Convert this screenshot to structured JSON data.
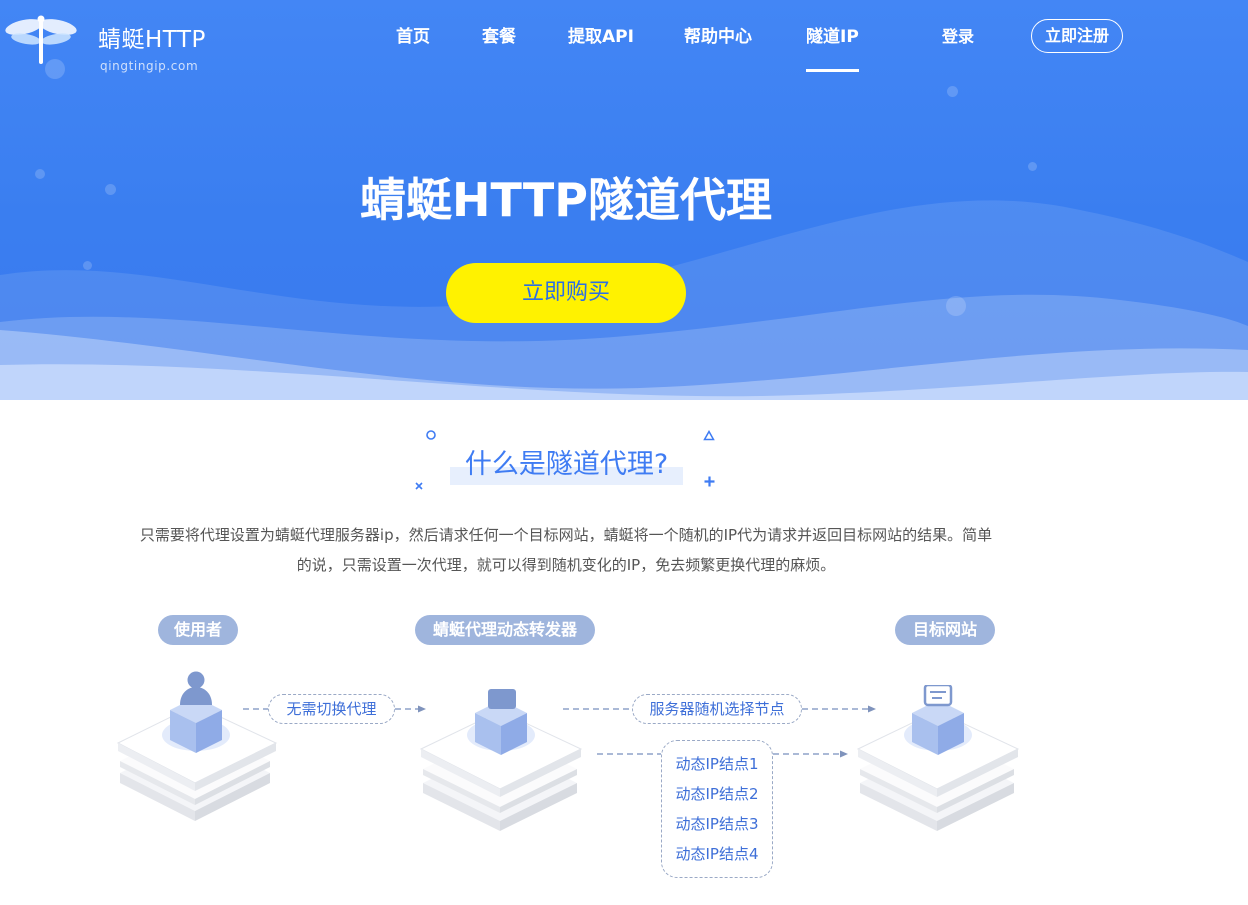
{
  "brand": {
    "name": "蜻蜓HTTP",
    "domain": "qingtingip.com"
  },
  "nav": {
    "items": [
      {
        "label": "首页",
        "active": false
      },
      {
        "label": "套餐",
        "active": false
      },
      {
        "label": "提取API",
        "active": false
      },
      {
        "label": "帮助中心",
        "active": false
      },
      {
        "label": "隧道IP",
        "active": true
      }
    ],
    "login_label": "登录",
    "register_label": "立即注册"
  },
  "hero": {
    "title": "蜻蜓HTTP隧道代理",
    "buy_label": "立即购买"
  },
  "intro": {
    "title": "什么是隧道代理?",
    "desc_line1": "只需要将代理设置为蜻蜓代理服务器ip，然后请求任何一个目标网站，蜻蜓将一个随机的IP代为请求并返回目标网站的结果。简单",
    "desc_line2": "的说，只需设置一次代理，就可以得到随机变化的IP，免去频繁更换代理的麻烦。"
  },
  "diagram": {
    "user_label": "使用者",
    "forwarder_label": "蜻蜓代理动态转发器",
    "target_label": "目标网站",
    "no_switch_label": "无需切换代理",
    "random_node_label": "服务器随机选择节点",
    "nodes": [
      "动态IP结点1",
      "动态IP结点2",
      "动态IP结点3",
      "动态IP结点4"
    ]
  },
  "colors": {
    "hero_blue": "#3a7ef0",
    "buy_yellow": "#fff200",
    "accent_blue": "#3f7cf3",
    "pill_gray_blue": "#9fb5dd"
  }
}
